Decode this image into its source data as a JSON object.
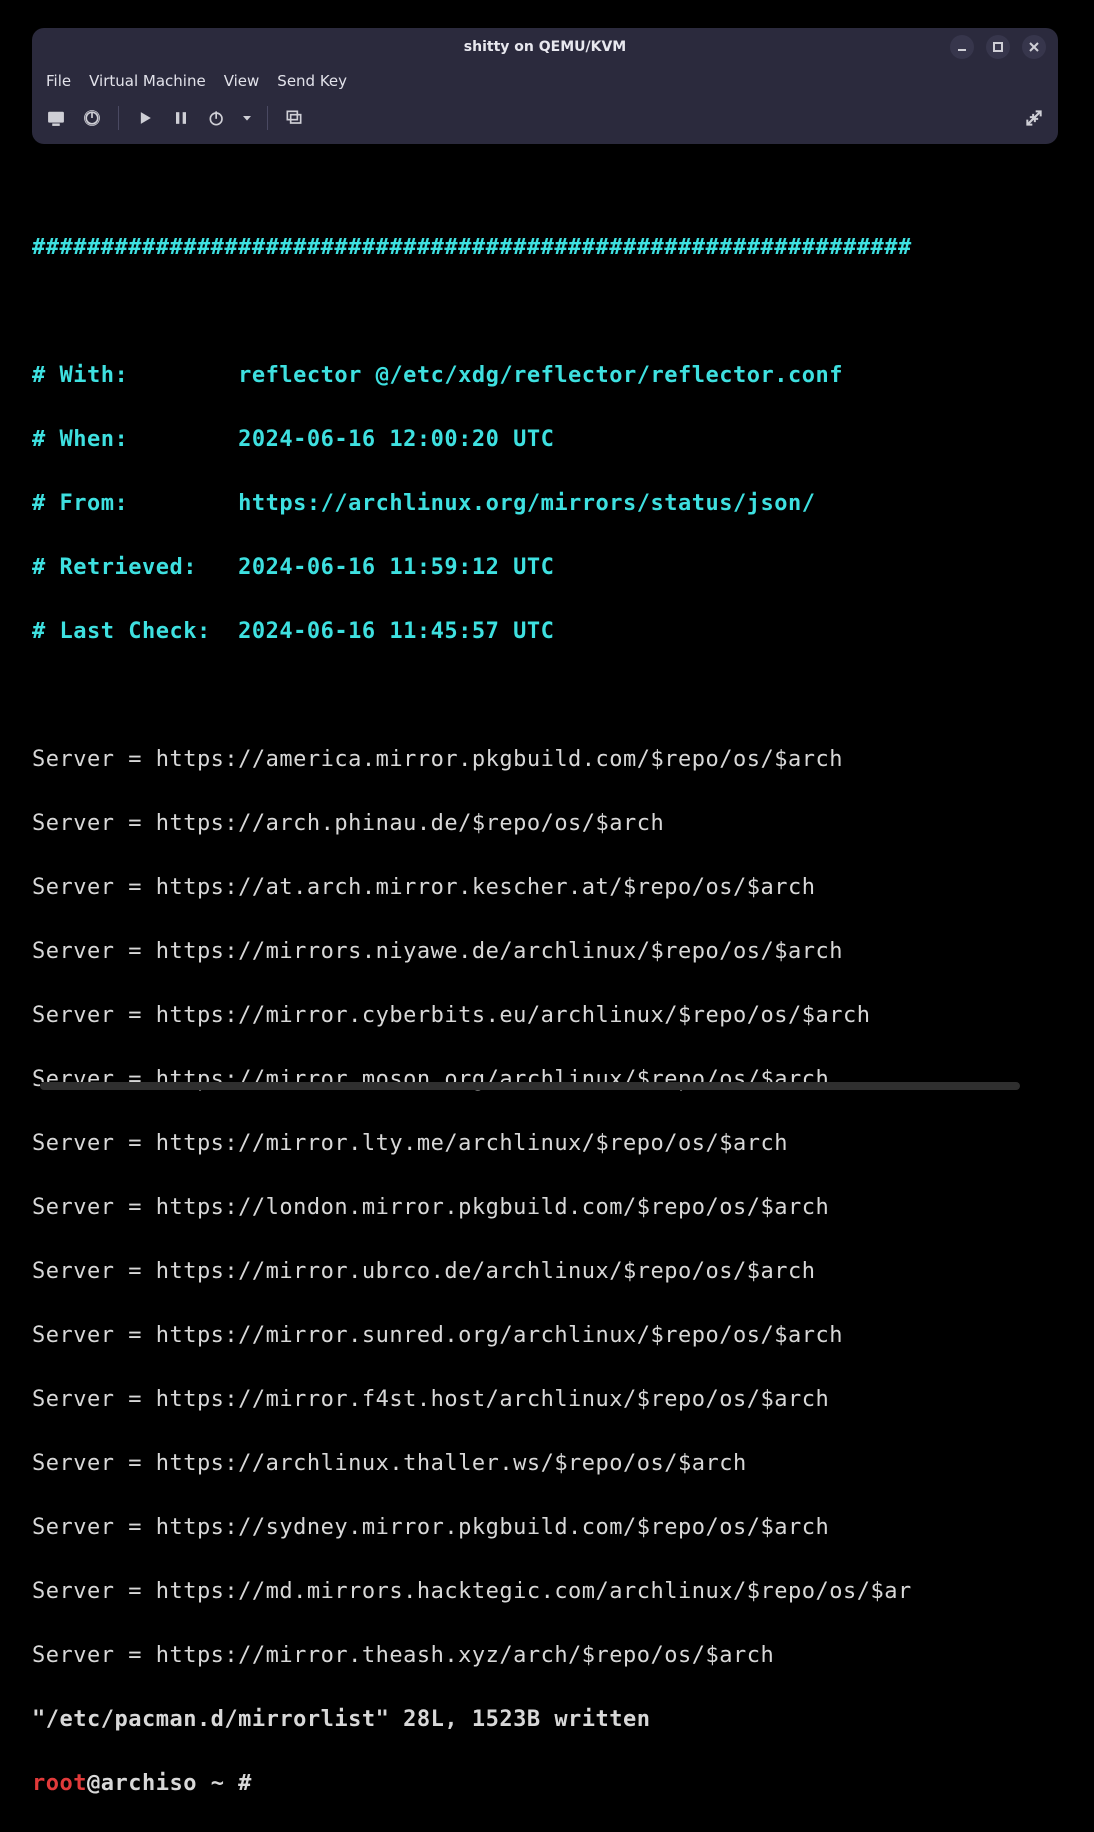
{
  "window": {
    "title": "shitty on QEMU/KVM",
    "menu": [
      "File",
      "Virtual Machine",
      "View",
      "Send Key"
    ]
  },
  "terminal": {
    "hashline": "################################################################",
    "comments": [
      "# With:        reflector @/etc/xdg/reflector/reflector.conf",
      "# When:        2024-06-16 12:00:20 UTC",
      "# From:        https://archlinux.org/mirrors/status/json/",
      "# Retrieved:   2024-06-16 11:59:12 UTC",
      "# Last Check:  2024-06-16 11:45:57 UTC"
    ],
    "servers": [
      "Server = https://america.mirror.pkgbuild.com/$repo/os/$arch",
      "Server = https://arch.phinau.de/$repo/os/$arch",
      "Server = https://at.arch.mirror.kescher.at/$repo/os/$arch",
      "Server = https://mirrors.niyawe.de/archlinux/$repo/os/$arch",
      "Server = https://mirror.cyberbits.eu/archlinux/$repo/os/$arch",
      "Server = https://mirror.moson.org/archlinux/$repo/os/$arch",
      "Server = https://mirror.lty.me/archlinux/$repo/os/$arch",
      "Server = https://london.mirror.pkgbuild.com/$repo/os/$arch",
      "Server = https://mirror.ubrco.de/archlinux/$repo/os/$arch",
      "Server = https://mirror.sunred.org/archlinux/$repo/os/$arch",
      "Server = https://mirror.f4st.host/archlinux/$repo/os/$arch",
      "Server = https://archlinux.thaller.ws/$repo/os/$arch",
      "Server = https://sydney.mirror.pkgbuild.com/$repo/os/$arch",
      "Server = https://md.mirrors.hacktegic.com/archlinux/$repo/os/$ar",
      "Server = https://mirror.theash.xyz/arch/$repo/os/$arch"
    ],
    "status_line": "\"/etc/pacman.d/mirrorlist\" 28L, 1523B written",
    "prompt_user": "root",
    "prompt_rest": "@archiso ~ # "
  }
}
